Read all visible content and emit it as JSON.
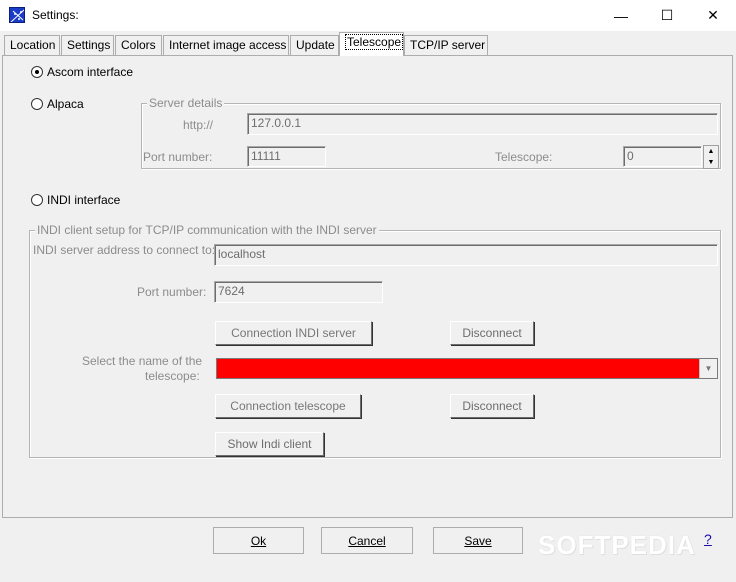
{
  "window": {
    "title": "Settings:",
    "minimize_glyph": "—",
    "maximize_glyph": "☐",
    "close_glyph": "✕"
  },
  "tabs": [
    {
      "label": "Location"
    },
    {
      "label": "Settings"
    },
    {
      "label": "Colors"
    },
    {
      "label": "Internet image access"
    },
    {
      "label": "Update"
    },
    {
      "label": "Telescope",
      "active": true
    },
    {
      "label": "TCP/IP server"
    }
  ],
  "telescope": {
    "ascom_label": "Ascom interface",
    "alpaca_label": "Alpaca",
    "indi_label": "INDI interface",
    "selected": "ascom",
    "server_details": {
      "legend": "Server details",
      "http_label": "http://",
      "http_value": "127.0.0.1",
      "port_label": "Port number:",
      "port_value": "11111",
      "telescope_label": "Telescope:",
      "telescope_value": "0"
    },
    "indi_setup": {
      "legend": "INDI client setup for TCP/IP communication with the INDI server",
      "address_label": "INDI server address to connect to:",
      "address_value": "localhost",
      "port_label": "Port number:",
      "port_value": "7624",
      "connect_server_label": "Connection INDI server",
      "disconnect_label": "Disconnect",
      "select_name_label_line1": "Select the name of the",
      "select_name_label_line2": "telescope:",
      "select_value": "",
      "select_color": "#ff0000",
      "connect_telescope_label": "Connection telescope",
      "disconnect2_label": "Disconnect",
      "show_client_label": "Show Indi client"
    }
  },
  "footer": {
    "ok_label": "Ok",
    "cancel_label": "Cancel",
    "save_label": "Save",
    "help_label": "?",
    "watermark": "SOFTPEDIA"
  }
}
